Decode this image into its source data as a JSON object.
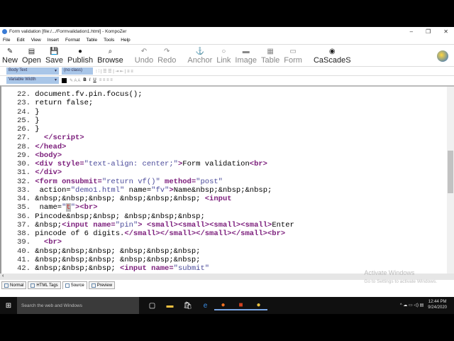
{
  "window": {
    "title": "Form validation [file:/.../Formvalidation1.html] - KompoZer",
    "minimize": "–",
    "restore": "❐",
    "close": "✕"
  },
  "menu": [
    "File",
    "Edit",
    "View",
    "Insert",
    "Format",
    "Table",
    "Tools",
    "Help"
  ],
  "toolbar": [
    {
      "label": "New",
      "icon": "✎",
      "disabled": false
    },
    {
      "label": "Open",
      "icon": "▤",
      "disabled": false
    },
    {
      "label": "Save",
      "icon": "💾",
      "disabled": false
    },
    {
      "label": "Publish",
      "icon": "●",
      "disabled": false
    },
    {
      "label": "Browse",
      "icon": "⌕",
      "disabled": false
    },
    {
      "label": "Undo",
      "icon": "↶",
      "disabled": true
    },
    {
      "label": "Redo",
      "icon": "↷",
      "disabled": true
    },
    {
      "label": "Anchor",
      "icon": "⚓",
      "disabled": true
    },
    {
      "label": "Link",
      "icon": "○",
      "disabled": true
    },
    {
      "label": "Image",
      "icon": "▬",
      "disabled": true
    },
    {
      "label": "Table",
      "icon": "▦",
      "disabled": true
    },
    {
      "label": "Form",
      "icon": "▭",
      "disabled": true
    },
    {
      "label": "CaScadeS",
      "icon": "◉",
      "disabled": false
    }
  ],
  "format": {
    "paragraph": "Body Text",
    "class": "(no class)",
    "font": "Variable Width",
    "bold": "B",
    "italic": "I",
    "underline": "U"
  },
  "code": [
    {
      "n": "22.",
      "segs": [
        [
          "txt",
          " document.fv.pin.focus();"
        ]
      ]
    },
    {
      "n": "23.",
      "segs": [
        [
          "txt",
          " return false;"
        ]
      ]
    },
    {
      "n": "24.",
      "segs": [
        [
          "txt",
          " }"
        ]
      ]
    },
    {
      "n": "25.",
      "segs": [
        [
          "txt",
          " }"
        ]
      ]
    },
    {
      "n": "26.",
      "segs": [
        [
          "txt",
          " }"
        ]
      ]
    },
    {
      "n": "27.",
      "segs": [
        [
          "txt",
          "   "
        ],
        [
          "tag",
          "</script>"
        ]
      ]
    },
    {
      "n": "28.",
      "segs": [
        [
          "txt",
          " "
        ],
        [
          "tag",
          "</head>"
        ]
      ]
    },
    {
      "n": "29.",
      "segs": [
        [
          "txt",
          " "
        ],
        [
          "tag",
          "<body>"
        ]
      ]
    },
    {
      "n": "30.",
      "segs": [
        [
          "txt",
          " "
        ],
        [
          "tag",
          "<div style="
        ],
        [
          "val",
          "\"text-align: center;\""
        ],
        [
          "tag",
          ">"
        ],
        [
          "txt",
          "Form validation"
        ],
        [
          "tag",
          "<br>"
        ]
      ]
    },
    {
      "n": "31.",
      "segs": [
        [
          "txt",
          " "
        ],
        [
          "tag",
          "</div>"
        ]
      ]
    },
    {
      "n": "32.",
      "segs": [
        [
          "txt",
          " "
        ],
        [
          "tag",
          "<form onsubmit="
        ],
        [
          "val",
          "\"return vf()\""
        ],
        [
          "tag",
          " method="
        ],
        [
          "val",
          "\"post\""
        ]
      ]
    },
    {
      "n": "33.",
      "segs": [
        [
          "txt",
          "  action="
        ],
        [
          "val",
          "\"demo1.html\""
        ],
        [
          "txt",
          " name="
        ],
        [
          "val",
          "\"fv\""
        ],
        [
          "tag",
          ">"
        ],
        [
          "txt",
          "Name&nbsp;&nbsp;&nbsp;"
        ]
      ]
    },
    {
      "n": "34.",
      "segs": [
        [
          "txt",
          " &nbsp;&nbsp;&nbsp; &nbsp;&nbsp;&nbsp; "
        ],
        [
          "tag",
          "<input"
        ]
      ]
    },
    {
      "n": "35.",
      "segs": [
        [
          "txt",
          "  name="
        ],
        [
          "val",
          "\""
        ],
        [
          "hl",
          "t"
        ],
        [
          "val",
          "\""
        ],
        [
          "tag",
          ">"
        ],
        [
          "tag",
          "<br>"
        ]
      ]
    },
    {
      "n": "36.",
      "segs": [
        [
          "txt",
          " Pincode&nbsp;&nbsp; &nbsp;&nbsp;&nbsp;"
        ]
      ]
    },
    {
      "n": "37.",
      "segs": [
        [
          "txt",
          " &nbsp;"
        ],
        [
          "tag",
          "<input name="
        ],
        [
          "val",
          "\"pin\""
        ],
        [
          "tag",
          ">"
        ],
        [
          "txt",
          " "
        ],
        [
          "tag",
          "<small><small><small><small>"
        ],
        [
          "txt",
          "Enter"
        ]
      ]
    },
    {
      "n": "38.",
      "segs": [
        [
          "txt",
          " pincode of 6 digits."
        ],
        [
          "tag",
          "</small></small></small></small><br>"
        ]
      ]
    },
    {
      "n": "39.",
      "segs": [
        [
          "txt",
          "   "
        ],
        [
          "tag",
          "<br>"
        ]
      ]
    },
    {
      "n": "40.",
      "segs": [
        [
          "txt",
          " &nbsp;&nbsp;&nbsp; &nbsp;&nbsp;&nbsp;"
        ]
      ]
    },
    {
      "n": "41.",
      "segs": [
        [
          "txt",
          " &nbsp;&nbsp;&nbsp; &nbsp;&nbsp;&nbsp;"
        ]
      ]
    },
    {
      "n": "42.",
      "segs": [
        [
          "txt",
          " &nbsp;&nbsp;&nbsp; "
        ],
        [
          "tag",
          "<input name="
        ],
        [
          "val",
          "\"submit\""
        ]
      ]
    }
  ],
  "tabs": [
    {
      "label": "Normal",
      "active": false
    },
    {
      "label": "HTML Tags",
      "active": false
    },
    {
      "label": "Source",
      "active": true
    },
    {
      "label": "Preview",
      "active": false
    }
  ],
  "watermark": {
    "title": "Activate Windows",
    "sub": "Go to Settings to activate Windows."
  },
  "taskbar": {
    "search_placeholder": "Search the web and Windows",
    "time": "12:44 PM",
    "date": "9/24/2020"
  }
}
